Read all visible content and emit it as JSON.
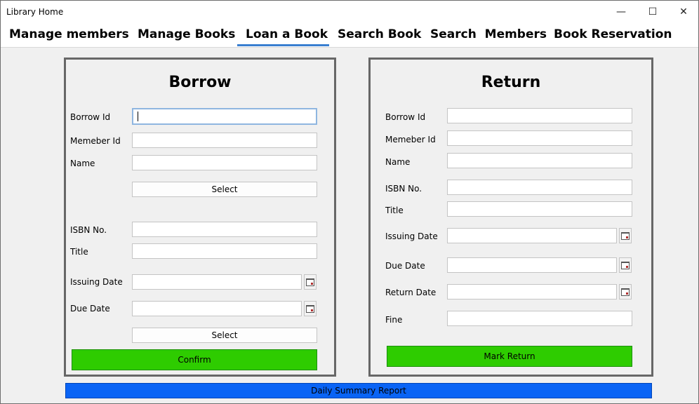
{
  "window": {
    "title": "Library Home",
    "minimize_glyph": "—",
    "maximize_glyph": "☐",
    "close_glyph": "✕"
  },
  "tabs": [
    {
      "label": "Manage members"
    },
    {
      "label": "Manage Books"
    },
    {
      "label": "Loan a Book",
      "selected": true
    },
    {
      "label": "Search Book"
    },
    {
      "label": "Search  Members"
    },
    {
      "label": "Book Reservation"
    }
  ],
  "borrow": {
    "title": "Borrow",
    "borrow_id_label": "Borrow Id",
    "borrow_id_value": "",
    "member_id_label": "Memeber Id",
    "name_label": "Name",
    "select_member_label": "Select",
    "isbn_label": "ISBN No.",
    "title_label": "Title",
    "issuing_date_label": "Issuing Date",
    "due_date_label": "Due Date",
    "select_book_label": "Select",
    "confirm_label": "Confirm"
  },
  "return": {
    "title": "Return",
    "borrow_id_label": "Borrow Id",
    "member_id_label": "Memeber Id",
    "name_label": "Name",
    "isbn_label": "ISBN No.",
    "title_label": "Title",
    "issuing_date_label": "Issuing Date",
    "due_date_label": "Due Date",
    "return_date_label": "Return Date",
    "fine_label": "Fine",
    "mark_return_label": "Mark Return"
  },
  "report": {
    "label": "Daily Summary Report"
  },
  "colors": {
    "confirm_bg": "#2ecc00",
    "report_bg": "#0a64f5",
    "tab_underline": "#3a7fd0"
  },
  "icons": {
    "calendar": "calendar-icon"
  }
}
